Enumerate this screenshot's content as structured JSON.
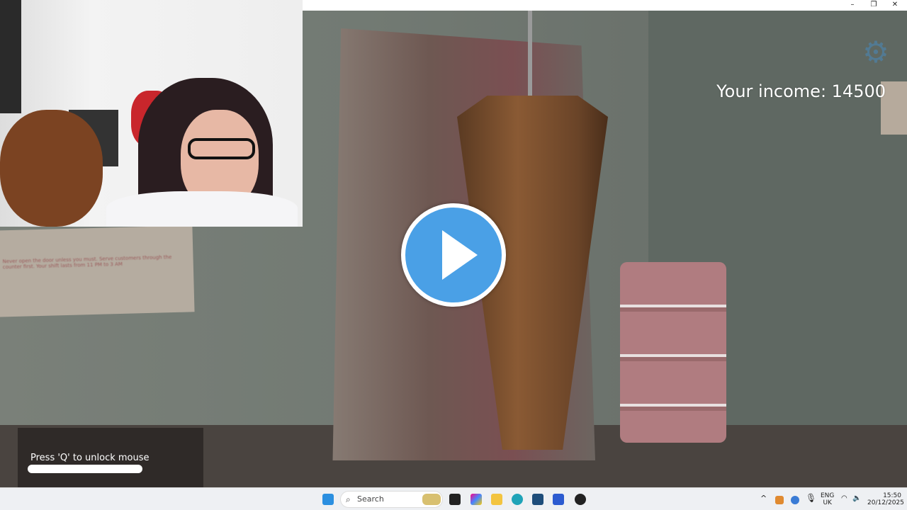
{
  "game": {
    "income_label": "Your income: 14500",
    "unlock_hint": "Press 'Q' to unlock mouse",
    "note_text": "Never open the door unless you must. Serve customers through the counter first. Your shift lasts from 11 PM to 3 AM",
    "settings_icon": "gear-icon"
  },
  "window": {
    "minimize": "–",
    "restore": "❐",
    "close": "✕"
  },
  "video": {
    "play_icon": "play-icon",
    "accent": "#4aa0e6"
  },
  "taskbar": {
    "search_placeholder": "Search",
    "apps": [
      "start",
      "search-highlight",
      "task-view",
      "copilot",
      "file-explorer",
      "edge",
      "store",
      "roblox-studio",
      "obs"
    ],
    "tray": {
      "language": "ENG",
      "region": "UK",
      "time": "15:50",
      "date": "20/12/2025"
    }
  }
}
